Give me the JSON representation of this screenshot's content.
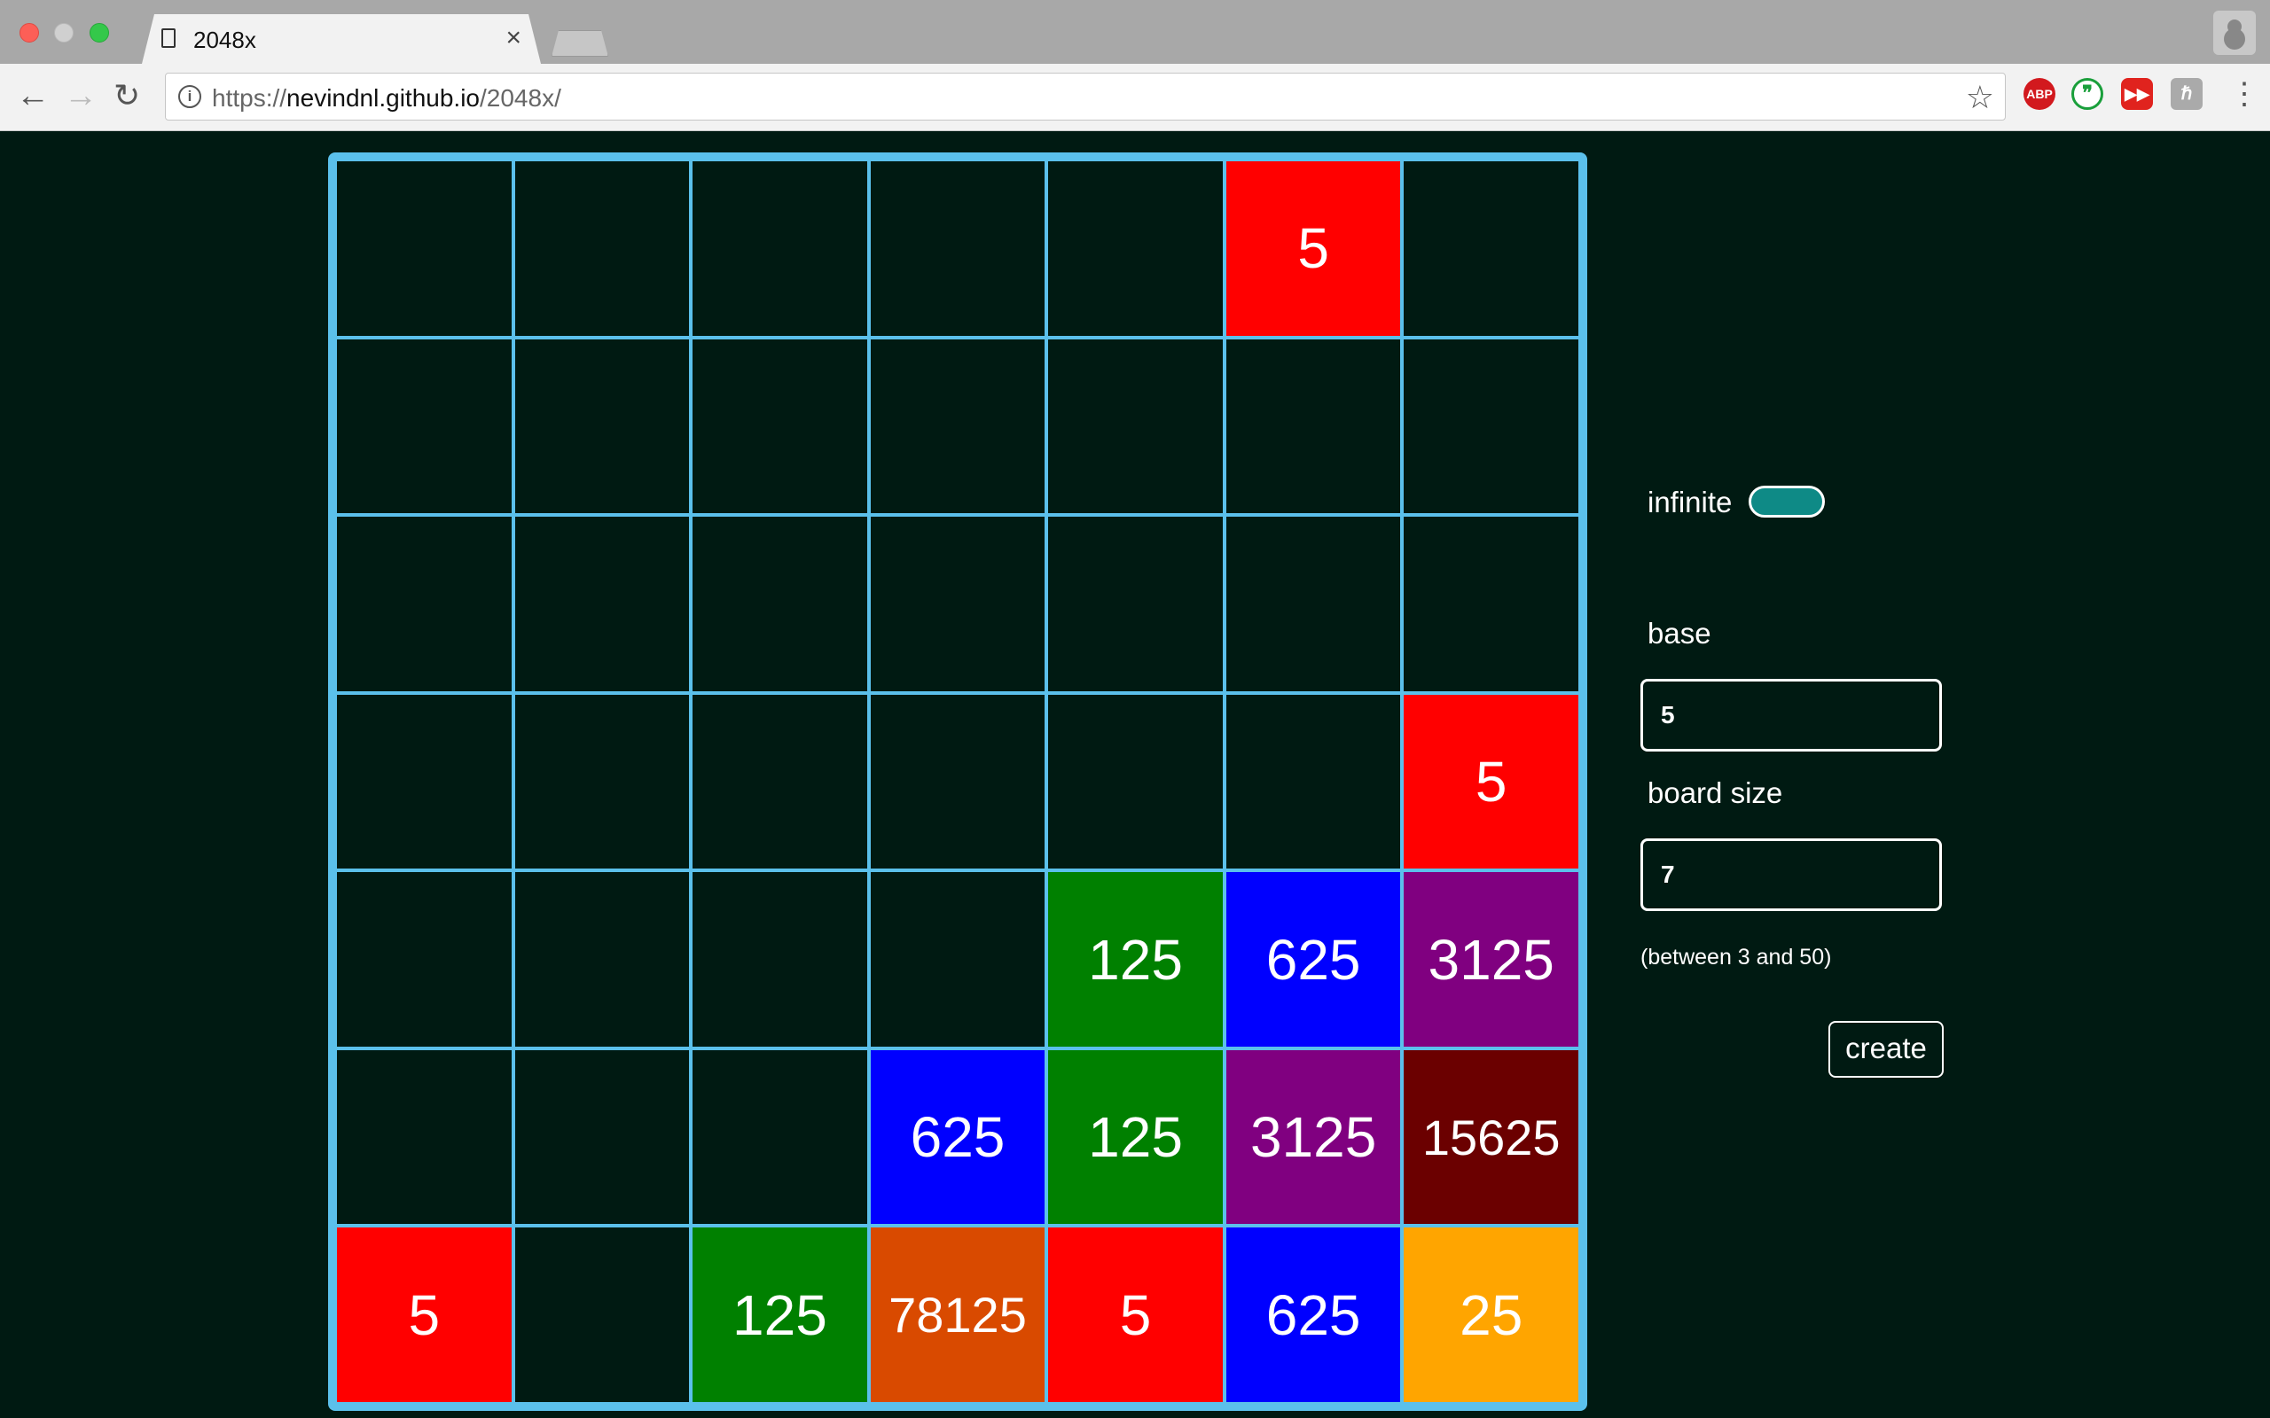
{
  "browser": {
    "tab_title": "2048x",
    "tab_close": "×",
    "url_prefix": "https://",
    "url_host": "nevindnl.github.io",
    "url_path": "/2048x/",
    "extensions": [
      "ABP",
      "❞",
      "▶▶",
      "ℏ"
    ]
  },
  "board": {
    "size": 7,
    "rows": [
      [
        "",
        "",
        "",
        "",
        "",
        "5",
        ""
      ],
      [
        "",
        "",
        "",
        "",
        "",
        "",
        ""
      ],
      [
        "",
        "",
        "",
        "",
        "",
        "",
        ""
      ],
      [
        "",
        "",
        "",
        "",
        "",
        "",
        "5"
      ],
      [
        "",
        "",
        "",
        "",
        "125",
        "625",
        "3125"
      ],
      [
        "",
        "",
        "",
        "625",
        "125",
        "3125",
        "15625"
      ],
      [
        "5",
        "",
        "125",
        "78125",
        "5",
        "625",
        "25"
      ]
    ],
    "tile_colors": {
      "5": "#ff0000",
      "25": "#ffa500",
      "125": "#008000",
      "625": "#0000ff",
      "3125": "#800080",
      "15625": "#6b0000",
      "78125": "#d94a00"
    },
    "empty_color": "#001a12",
    "border_color": "#5bc0eb"
  },
  "settings": {
    "infinite_label": "infinite",
    "infinite_on": true,
    "base_label": "base",
    "base_value": "5",
    "board_size_label": "board size",
    "board_size_value": "7",
    "hint": "(between 3 and 50)",
    "create_label": "create"
  }
}
